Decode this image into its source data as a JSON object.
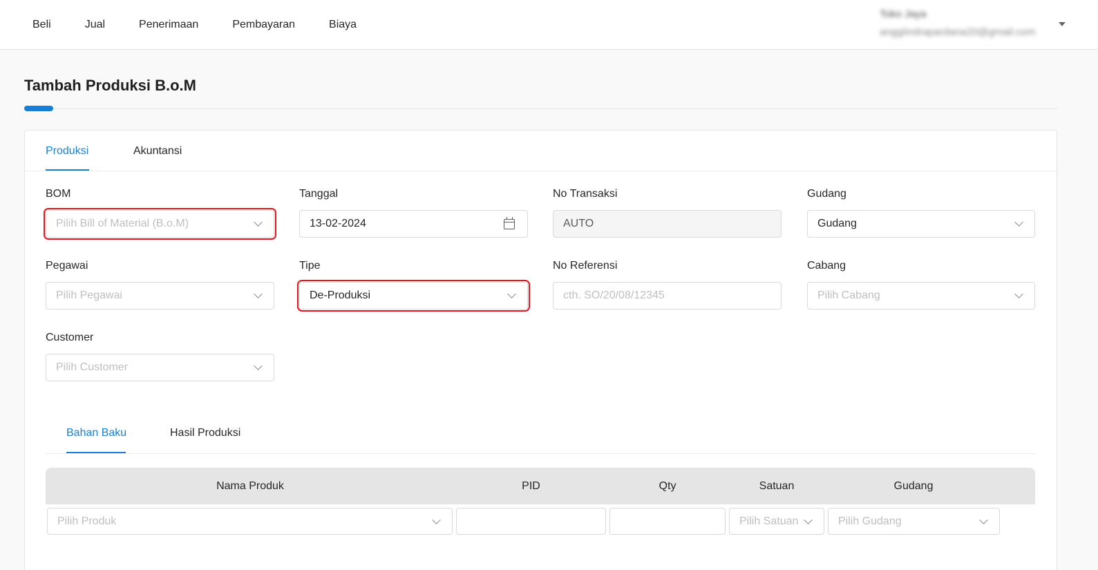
{
  "nav": {
    "items": [
      "Beli",
      "Jual",
      "Penerimaan",
      "Pembayaran",
      "Biaya"
    ]
  },
  "user": {
    "name": "Toko Jaya",
    "email": "anggiindrapardana20@gmail.com"
  },
  "page": {
    "title": "Tambah Produksi B.o.M"
  },
  "tabs": {
    "items": [
      "Produksi",
      "Akuntansi"
    ],
    "active": "Produksi"
  },
  "form": {
    "bom": {
      "label": "BOM",
      "placeholder": "Pilih Bill of Material (B.o.M)"
    },
    "tanggal": {
      "label": "Tanggal",
      "value": "13-02-2024"
    },
    "no_transaksi": {
      "label": "No Transaksi",
      "value": "AUTO"
    },
    "gudang": {
      "label": "Gudang",
      "value": "Gudang"
    },
    "pegawai": {
      "label": "Pegawai",
      "placeholder": "Pilih Pegawai"
    },
    "tipe": {
      "label": "Tipe",
      "value": "De-Produksi"
    },
    "no_referensi": {
      "label": "No Referensi",
      "placeholder": "cth. SO/20/08/12345"
    },
    "cabang": {
      "label": "Cabang",
      "placeholder": "Pilih Cabang"
    },
    "customer": {
      "label": "Customer",
      "placeholder": "Pilih Customer"
    }
  },
  "subtabs": {
    "items": [
      "Bahan Baku",
      "Hasil Produksi"
    ],
    "active": "Bahan Baku"
  },
  "table": {
    "headers": [
      "Nama Produk",
      "PID",
      "Qty",
      "Satuan",
      "Gudang"
    ],
    "row": {
      "produk_placeholder": "Pilih Produk",
      "pid": "",
      "qty": "",
      "satuan_placeholder": "Pilih Satuan",
      "gudang_placeholder": "Pilih Gudang"
    }
  },
  "colors": {
    "accent": "#1a7fd4",
    "highlight": "#e8141c"
  }
}
